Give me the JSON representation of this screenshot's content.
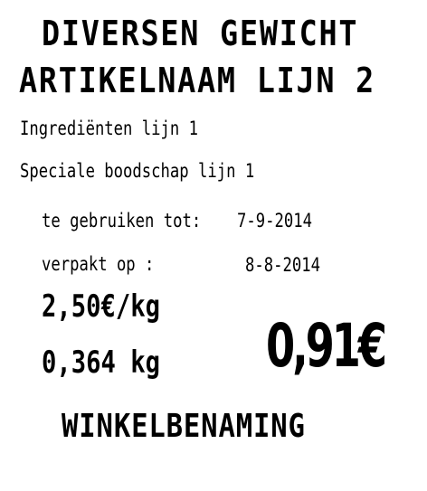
{
  "label": {
    "title_line1": "DIVERSEN GEWICHT",
    "title_line2": "ARTIKELNAAM LIJN 2",
    "ingredients_line": "Ingrediënten lijn 1",
    "special_message_line": "Speciale boodschap lijn 1",
    "use_by_label": "te gebruiken tot:",
    "use_by_date": "7-9-2014",
    "packed_on_label": "verpakt op :",
    "packed_on_date": "8-8-2014",
    "unit_price": "2,50€/kg",
    "weight": "0,364 kg",
    "total_price": "0,91€",
    "shop_name": "WINKELBENAMING"
  },
  "colors": {
    "background": "#ffffff",
    "text": "#000000"
  }
}
